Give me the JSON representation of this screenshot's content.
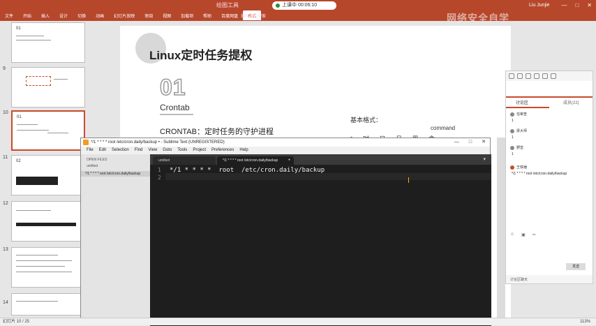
{
  "ribbon": {
    "doc_title": "绘图工具",
    "recording_label": "上课中 00:06:10",
    "search_hint": "操作说明搜索",
    "watermark": "网络安全自学",
    "user": "Liu Junjie",
    "tabs": [
      "文件",
      "开始",
      "插入",
      "设计",
      "切换",
      "动画",
      "幻灯片放映",
      "审阅",
      "视图",
      "加载项",
      "帮助",
      "百度网盘",
      "格式"
    ],
    "active_tab": "格式",
    "win_controls": [
      "—",
      "□",
      "✕"
    ]
  },
  "thumbnails": [
    {
      "num": "",
      "title": "01"
    },
    {
      "num": "9",
      "title": ""
    },
    {
      "num": "10",
      "title": "01"
    },
    {
      "num": "11",
      "title": "02"
    },
    {
      "num": "12",
      "title": ""
    },
    {
      "num": "13",
      "title": ""
    },
    {
      "num": "14",
      "title": ""
    }
  ],
  "slide": {
    "title": "Linux定时任务提权",
    "number": "01",
    "subtitle": "Crontab",
    "description": "CRONTAB：定时任务的守护进程",
    "format_label": "基本格式：",
    "command_label": "command",
    "fields": "* 时 日 月 周 命"
  },
  "sublime": {
    "title": "*/1 * * * * root /etc/cron.daily/backup • - Sublime Text (UNREGISTERED)",
    "menus": [
      "File",
      "Edit",
      "Selection",
      "Find",
      "View",
      "Goto",
      "Tools",
      "Project",
      "Preferences",
      "Help"
    ],
    "sidebar_header": "OPEN FILES",
    "sidebar_untitled": "untitled",
    "sidebar_file": "*/1 * * * * root /etc/cron.daily/backup",
    "tabs": [
      {
        "label": "untitled",
        "active": false
      },
      {
        "label": "*/1 * * * * root /etc/cron.daily/backup",
        "active": true
      }
    ],
    "lines": [
      "*/1 * * * *  root  /etc/cron.daily/backup",
      ""
    ],
    "line_numbers": [
      "1",
      "2"
    ]
  },
  "chat": {
    "tabs": [
      "讨论区",
      "成员(22)"
    ],
    "messages": [
      {
        "name": "任审查",
        "text": "1"
      },
      {
        "name": "梁大师",
        "text": "1"
      },
      {
        "name": "野蛮",
        "text": "1"
      },
      {
        "name": "王铁锤",
        "text": "*/1 * * * * root /etc/cron.daily/backup"
      }
    ],
    "send_label": "发送",
    "footer": "讨论区聊天"
  },
  "statusbar": {
    "left": "幻灯片 10 / 25",
    "zoom": "113%"
  }
}
